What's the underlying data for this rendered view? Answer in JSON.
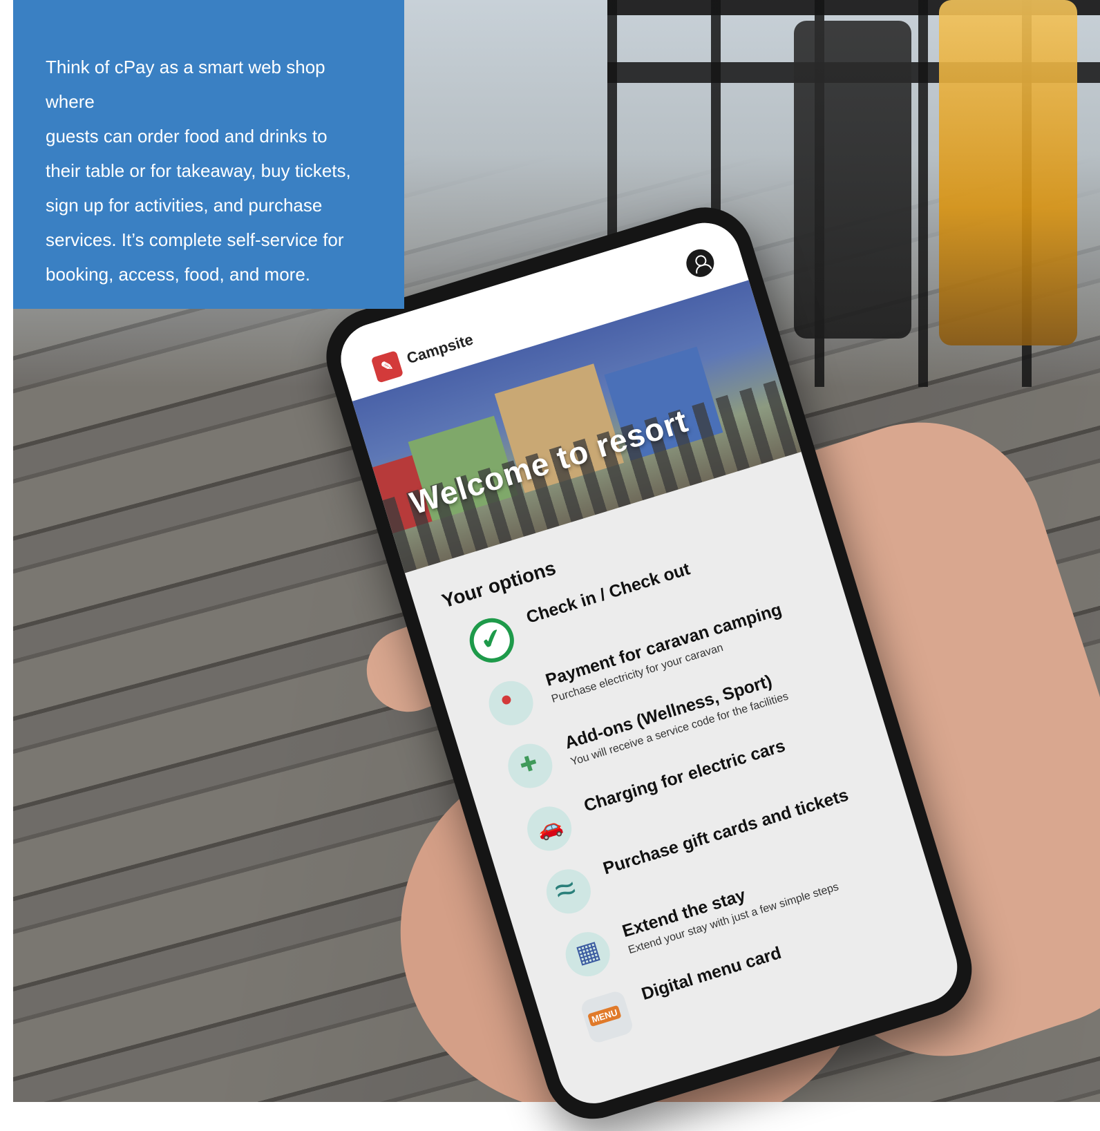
{
  "info_card": {
    "lines": [
      "Think of cPay as a smart web shop where",
      "guests can order food and drinks to",
      "their table or for takeaway, buy tickets,",
      "sign up for activities, and purchase",
      "services. It’s complete self-service for",
      "booking, access, food, and more."
    ],
    "background_color": "#3a80c3"
  },
  "phone": {
    "brand": "Campsite",
    "hero_title": "Welcome to resort",
    "options_heading": "Your options",
    "options": [
      {
        "icon": "checkmark-icon",
        "title": "Check in / Check out",
        "subtitle": ""
      },
      {
        "icon": "power-plug-icon",
        "title": "Payment for caravan camping",
        "subtitle": "Purchase electricity for your caravan"
      },
      {
        "icon": "plus-icon",
        "title": "Add-ons (Wellness, Sport)",
        "subtitle": "You will receive a service code for the facilities"
      },
      {
        "icon": "electric-car-icon",
        "title": "Charging for electric cars",
        "subtitle": ""
      },
      {
        "icon": "waves-icon",
        "title": "Purchase gift cards and tickets",
        "subtitle": ""
      },
      {
        "icon": "calendar-icon",
        "title": "Extend the stay",
        "subtitle": "Extend your stay with just a few simple steps"
      },
      {
        "icon": "menu-card-icon",
        "title": "Digital menu card",
        "subtitle": ""
      }
    ]
  }
}
